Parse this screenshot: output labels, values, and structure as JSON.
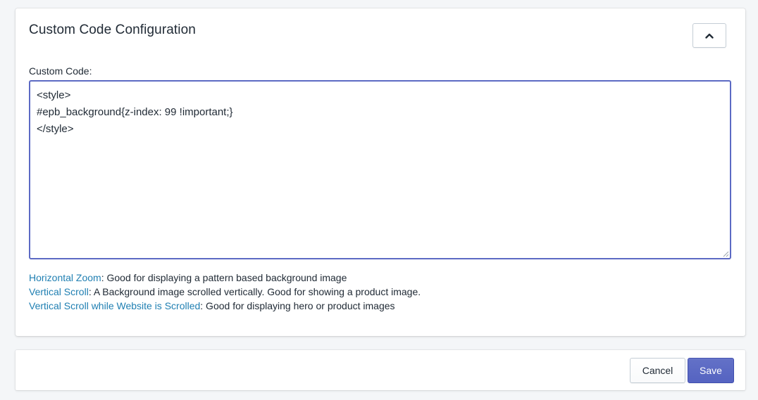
{
  "card": {
    "title": "Custom Code Configuration",
    "collapse_icon": "chevron-up-icon"
  },
  "custom_code": {
    "label": "Custom Code:",
    "value": "<style>\n#epb_background{z-index: 99 !important;}\n</style>"
  },
  "help": [
    {
      "link": "Horizontal Zoom",
      "text": ": Good for displaying a pattern based background image"
    },
    {
      "link": "Vertical Scroll",
      "text": ": A Background image scrolled vertically. Good for showing a product image."
    },
    {
      "link": "Vertical Scroll while Website is Scrolled",
      "text": ": Good for displaying hero or product images"
    }
  ],
  "footer": {
    "cancel_label": "Cancel",
    "save_label": "Save"
  },
  "colors": {
    "accent": "#5c6ac4",
    "link": "#1f7fb2",
    "background": "#f4f6f8"
  }
}
